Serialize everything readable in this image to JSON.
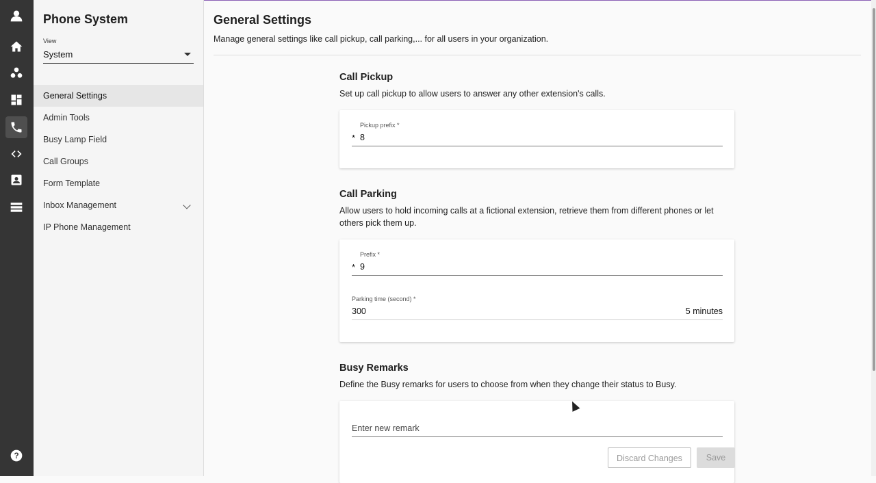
{
  "rail": {
    "icons": [
      "user-avatar-icon",
      "home-icon",
      "users-icon",
      "dashboard-icon",
      "phone-icon",
      "code-icon",
      "contacts-icon",
      "server-icon",
      "help-icon"
    ]
  },
  "sidebar": {
    "title": "Phone System",
    "view_label": "View",
    "view_value": "System",
    "items": [
      {
        "label": "General Settings"
      },
      {
        "label": "Admin Tools"
      },
      {
        "label": "Busy Lamp Field"
      },
      {
        "label": "Call Groups"
      },
      {
        "label": "Form Template"
      },
      {
        "label": "Inbox Management"
      },
      {
        "label": "IP Phone Management"
      }
    ]
  },
  "main": {
    "title": "General Settings",
    "description": "Manage general settings like call pickup, call parking,... for all users in your organization.",
    "call_pickup": {
      "title": "Call Pickup",
      "description": "Set up call pickup to allow users to answer any other extension's calls.",
      "field_label": "Pickup prefix *",
      "prefix": "*",
      "value": "8"
    },
    "call_parking": {
      "title": "Call Parking",
      "description": "Allow users to hold incoming calls at a fictional extension, retrieve them from different phones or let others pick them up.",
      "prefix_label": "Prefix *",
      "prefix_symbol": "*",
      "prefix_value": "9",
      "time_label": "Parking time (second) *",
      "time_value": "300",
      "time_suffix": "5 minutes"
    },
    "busy_remarks": {
      "title": "Busy Remarks",
      "description": "Define the Busy remarks for users to choose from when they change their status to Busy.",
      "input_placeholder": "Enter new remark",
      "discard_label": "Discard Changes",
      "save_label": "Save"
    }
  },
  "colors": {
    "rail": "#353535",
    "accent_line": "#8a5fb5"
  }
}
